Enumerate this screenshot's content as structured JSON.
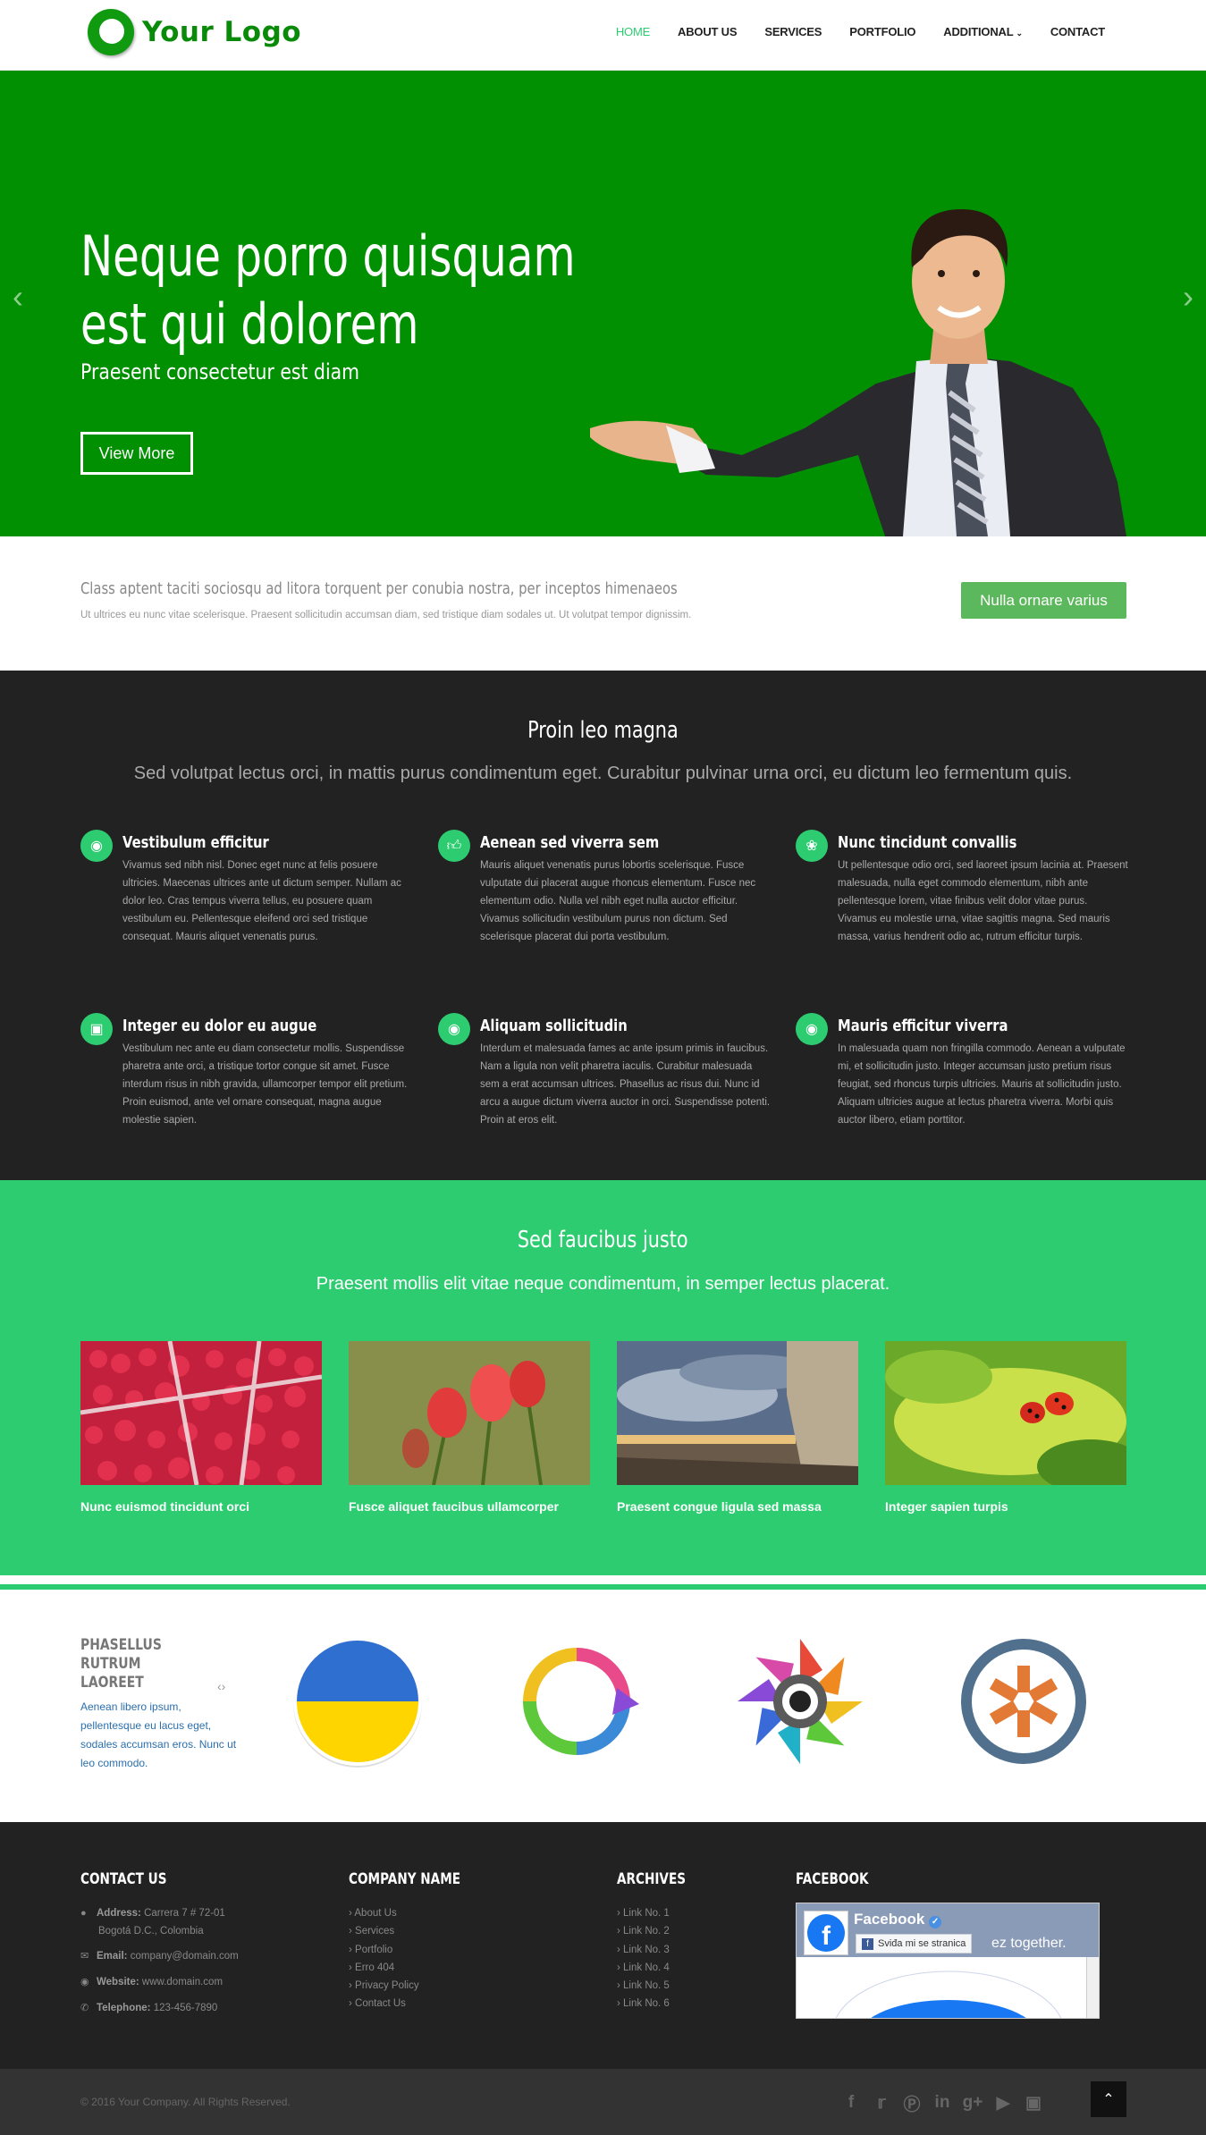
{
  "header": {
    "logo_text": "Your Logo",
    "nav": [
      {
        "label": "HOME",
        "active": true
      },
      {
        "label": "ABOUT US"
      },
      {
        "label": "SERVICES"
      },
      {
        "label": "PORTFOLIO"
      },
      {
        "label": "ADDITIONAL"
      },
      {
        "label": "CONTACT"
      }
    ]
  },
  "hero": {
    "title_line1": "Neque porro quisquam",
    "title_line2": "est qui dolorem",
    "subtitle": "Praesent consectetur est diam",
    "button": "View More",
    "bg_color": "#019001"
  },
  "callout": {
    "title": "Class aptent taciti sociosqu ad litora torquent per conubia nostra, per inceptos himenaeos",
    "text": "Ut ultrices eu nunc vitae scelerisque. Praesent sollicitudin accumsan diam, sed tristique diam sodales ut. Ut volutpat tempor dignissim.",
    "button": "Nulla ornare varius"
  },
  "services": {
    "title": "Proin leo magna",
    "subtitle": "Sed volutpat lectus orci, in mattis purus condimentum eget. Curabitur pulvinar urna orci, eu dictum leo fermentum quis.",
    "items": [
      {
        "icon": "globe-icon",
        "title": "Vestibulum efficitur",
        "text": "Vivamus sed nibh nisl. Donec eget nunc at felis posuere ultricies. Maecenas ultrices ante ut dictum semper. Nullam ac dolor leo. Cras tempus viverra tellus, eu posuere quam vestibulum eu. Pellentesque eleifend orci sed tristique consequat. Mauris aliquet venenatis purus."
      },
      {
        "icon": "thumbs-up-icon",
        "title": "Aenean sed viverra sem",
        "text": "Mauris aliquet venenatis purus lobortis scelerisque. Fusce vulputate dui placerat augue rhoncus elementum. Fusce nec elementum odio. Nulla vel nibh eget nulla auctor efficitur. Vivamus sollicitudin vestibulum purus non dictum. Sed scelerisque placerat dui porta vestibulum."
      },
      {
        "icon": "leaf-icon",
        "title": "Nunc tincidunt convallis",
        "text": "Ut pellentesque odio orci, sed laoreet ipsum lacinia at. Praesent malesuada, nulla eget commodo elementum, nibh ante pellentesque lorem, vitae finibus velit dolor vitae purus. Vivamus eu molestie urna, vitae sagittis magna. Sed mauris massa, varius hendrerit odio ac, rutrum efficitur turpis."
      },
      {
        "icon": "cart-icon",
        "title": "Integer eu dolor eu augue",
        "text": "Vestibulum nec ante eu diam consectetur mollis. Suspendisse pharetra ante orci, a tristique tortor congue sit amet. Fusce interdum risus in nibh gravida, ullamcorper tempor elit pretium. Proin euismod, ante vel ornare consequat, magna augue molestie sapien."
      },
      {
        "icon": "globe-icon",
        "title": "Aliquam sollicitudin",
        "text": "Interdum et malesuada fames ac ante ipsum primis in faucibus. Nam a ligula non velit pharetra iaculis. Curabitur malesuada sem a erat accumsan ultrices. Phasellus ac risus dui. Nunc id arcu a augue dictum viverra auctor in orci. Suspendisse potenti. Proin at eros elit."
      },
      {
        "icon": "globe-icon",
        "title": "Mauris efficitur viverra",
        "text": "In malesuada quam non fringilla commodo. Aenean a vulputate mi, et sollicitudin justo. Integer accumsan justo pretium risus feugiat, sed rhoncus turpis ultricies. Mauris at sollicitudin justo. Aliquam ultricies augue at lectus pharetra viverra. Morbi quis auctor libero, etiam porttitor."
      }
    ]
  },
  "portfolio": {
    "title": "Sed faucibus justo",
    "subtitle": "Praesent mollis elit vitae neque condimentum, in semper lectus placerat.",
    "items": [
      {
        "caption": "Nunc euismod tincidunt orci"
      },
      {
        "caption": "Fusce aliquet faucibus ullamcorper"
      },
      {
        "caption": "Praesent congue ligula sed massa"
      },
      {
        "caption": "Integer sapien turpis"
      }
    ]
  },
  "partners": {
    "title": "PHASELLUS RUTRUM LAOREET",
    "nav": "‹›",
    "text": "Aenean libero ipsum, pellentesque eu lacus eget, sodales accumsan eros. Nunc ut leo commodo."
  },
  "footer": {
    "contact": {
      "heading": "CONTACT US",
      "address_label": "Address:",
      "address_line1": "Carrera 7 # 72-01",
      "address_line2": "Bogotá D.C., Colombia",
      "email_label": "Email:",
      "email": "company@domain.com",
      "website_label": "Website:",
      "website": "www.domain.com",
      "phone_label": "Telephone:",
      "phone": "123-456-7890"
    },
    "company": {
      "heading": "COMPANY NAME",
      "links": [
        "About Us",
        "Services",
        "Portfolio",
        "Erro 404",
        "Privacy Policy",
        "Contact Us"
      ]
    },
    "archives": {
      "heading": "ARCHIVES",
      "links": [
        "Link No. 1",
        "Link No. 2",
        "Link No. 3",
        "Link No. 4",
        "Link No. 5",
        "Link No. 6"
      ]
    },
    "facebook": {
      "heading": "FACEBOOK",
      "page_name": "Facebook",
      "like_button": "Sviđa mi se stranica",
      "overlay_text": "ez together."
    }
  },
  "bottom": {
    "copyright": "© 2016 Your Company. All Rights Reserved.",
    "social": [
      "facebook-icon",
      "twitter-icon",
      "pinterest-icon",
      "linkedin-icon",
      "google-plus-icon",
      "youtube-icon",
      "instagram-icon"
    ]
  }
}
